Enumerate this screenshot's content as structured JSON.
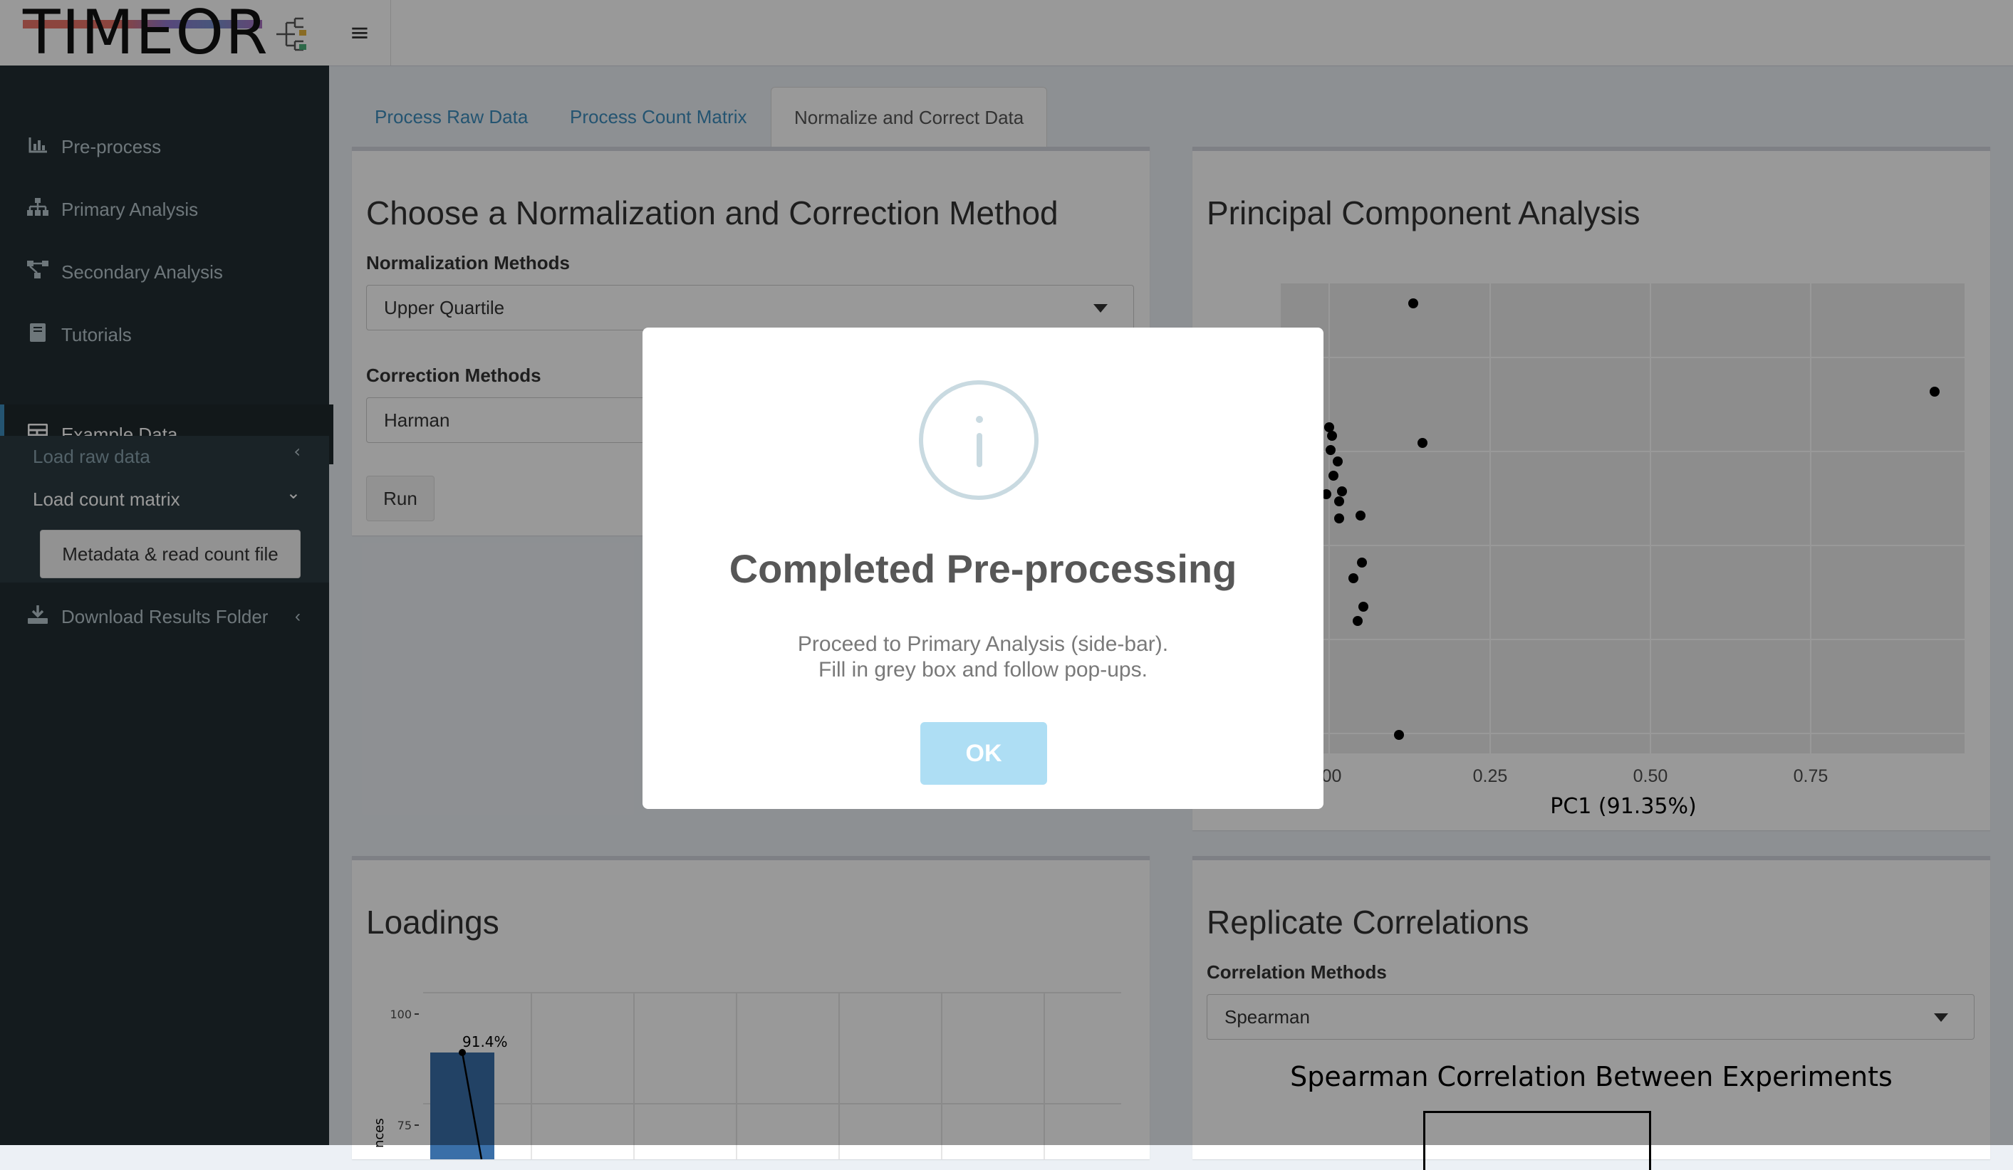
{
  "app": {
    "logo_text": "TIMEOR"
  },
  "header": {
    "menu_icon": "hamburger-icon"
  },
  "sidebar": {
    "items": [
      {
        "label": "Pre-process",
        "icon": "bar-chart-icon"
      },
      {
        "label": "Primary Analysis",
        "icon": "sitemap-icon"
      },
      {
        "label": "Secondary Analysis",
        "icon": "project-diagram-icon"
      },
      {
        "label": "Tutorials",
        "icon": "book-icon"
      },
      {
        "label": "Example Data",
        "icon": "table-icon"
      },
      {
        "label": "Download Results Folder",
        "icon": "download-icon"
      }
    ],
    "submenu": {
      "load_raw": "Load raw data",
      "load_count": "Load count matrix",
      "metadata_button": "Metadata & read count file"
    }
  },
  "tabs": [
    {
      "label": "Process Raw Data"
    },
    {
      "label": "Process Count Matrix"
    },
    {
      "label": "Normalize and Correct Data"
    }
  ],
  "normalize": {
    "title": "Choose a Normalization and Correction Method",
    "norm_label": "Normalization Methods",
    "norm_value": "Upper Quartile",
    "corr_label": "Correction Methods",
    "corr_value": "Harman",
    "run_label": "Run"
  },
  "pca": {
    "title": "Principal Component Analysis",
    "x_ticks": [
      ".00",
      "0.25",
      "0.50",
      "0.75"
    ],
    "x_label": "PC1 (91.35%)"
  },
  "loadings": {
    "title": "Loadings",
    "y_ticks": [
      "100",
      "75"
    ],
    "y_label": "nces",
    "bar_label": "91.4%"
  },
  "replicate": {
    "title": "Replicate Correlations",
    "method_label": "Correlation Methods",
    "method_value": "Spearman",
    "plot_title": "Spearman Correlation Between Experiments"
  },
  "modal": {
    "icon": "info-icon",
    "title": "Completed Pre-processing",
    "line1": "Proceed to Primary Analysis (side-bar).",
    "line2": "Fill in grey box and follow pop-ups.",
    "ok_label": "OK"
  },
  "colors": {
    "sidebar_bg": "#222d32",
    "link_blue": "#3c8dbc",
    "ok_button": "#aedef4",
    "bar_blue": "#3a6fa8"
  }
}
